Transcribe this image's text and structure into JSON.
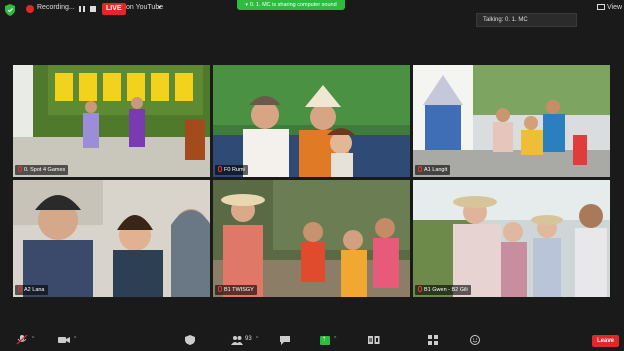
{
  "topbar": {
    "recording_label": "Recording...",
    "live_label": "LIVE",
    "destination_label": "on YouTube",
    "share_banner": "0. 1. MC is sharing computer sound",
    "view_label": "View",
    "talking_label": "Talking: 0. 1. MC"
  },
  "tiles": [
    {
      "name": "0. Spot 4 Games"
    },
    {
      "name": "F0 Rumi"
    },
    {
      "name": "A1 Langit"
    },
    {
      "name": "A2 Lana"
    },
    {
      "name": "B1 TWISGY"
    },
    {
      "name": "B1 Gwen - B2 Gili"
    }
  ],
  "bottombar": {
    "participants_count": "93",
    "leave_label": "Leave"
  },
  "colors": {
    "live_red": "#e02828",
    "share_green": "#2fbb3d",
    "background": "#1a1a1a"
  }
}
